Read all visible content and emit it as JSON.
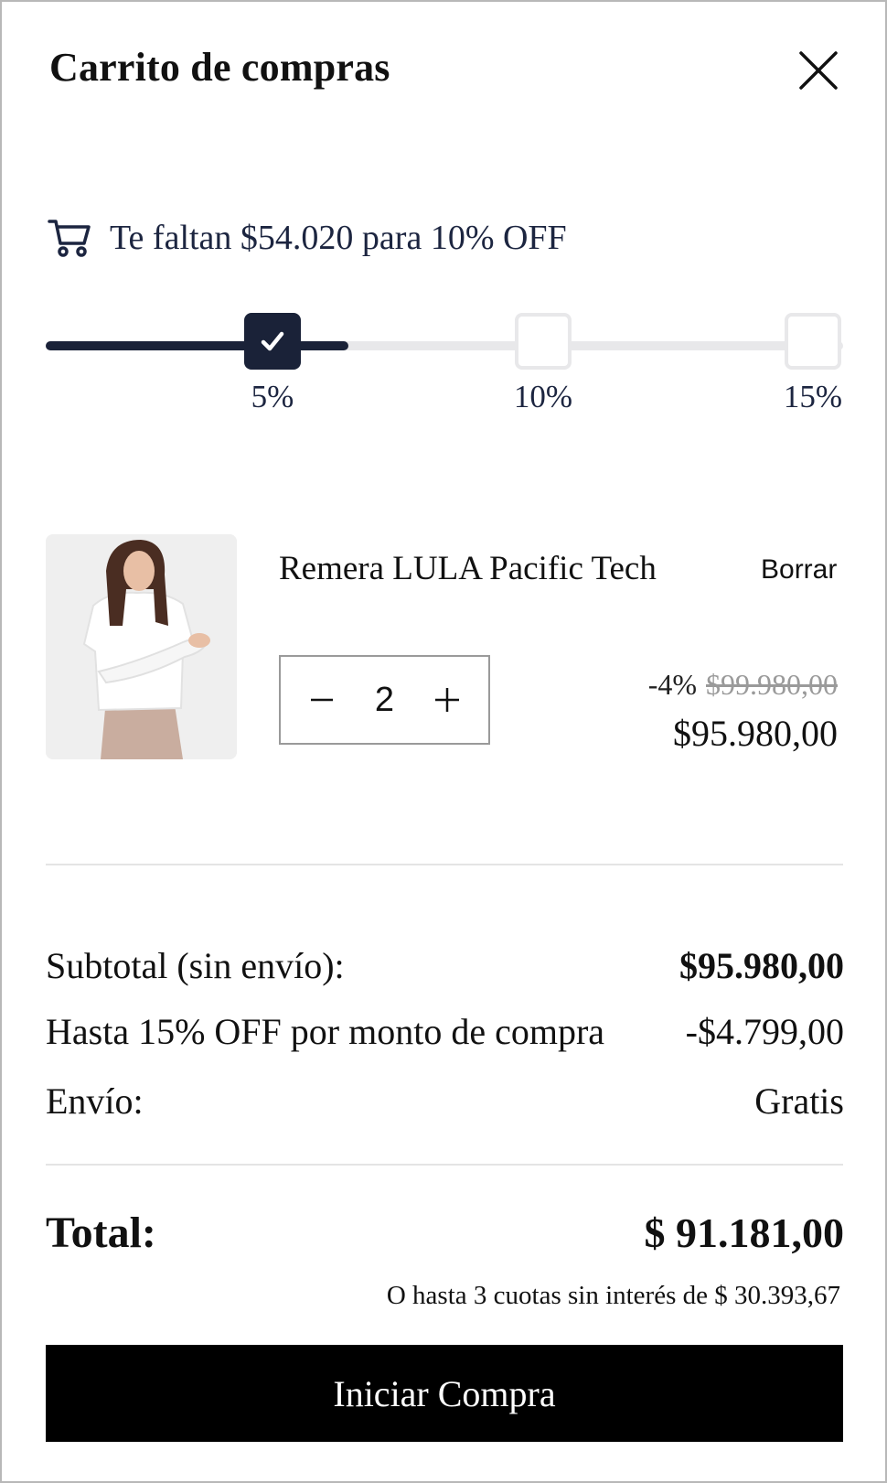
{
  "header": {
    "title": "Carrito de compras",
    "close_icon": "close-icon"
  },
  "promo": {
    "icon": "cart-icon",
    "text": "Te faltan $54.020 para 10% OFF"
  },
  "progress": {
    "fraction": 0.38,
    "tiers": [
      {
        "label": "5%",
        "reached": true
      },
      {
        "label": "10%",
        "reached": false
      },
      {
        "label": "15%",
        "reached": false
      }
    ]
  },
  "item": {
    "name": "Remera LULA Pacific Tech",
    "delete_label": "Borrar",
    "quantity": "2",
    "discount_pct": "-4%",
    "original_price": "$99.980,00",
    "price": "$95.980,00"
  },
  "summary": {
    "subtotal_label": "Subtotal (sin envío):",
    "subtotal_value": "$95.980,00",
    "discount_label": "Hasta 15% OFF por monto de compra",
    "discount_value": "-$4.799,00",
    "shipping_label": "Envío:",
    "shipping_value": "Gratis"
  },
  "total": {
    "label": "Total:",
    "value": "$ 91.181,00",
    "installments": "O hasta 3 cuotas sin interés de $ 30.393,67"
  },
  "checkout_label": "Iniciar Compra",
  "colors": {
    "accent": "#1a2238",
    "track": "#e8e8ea",
    "button": "#000000"
  }
}
